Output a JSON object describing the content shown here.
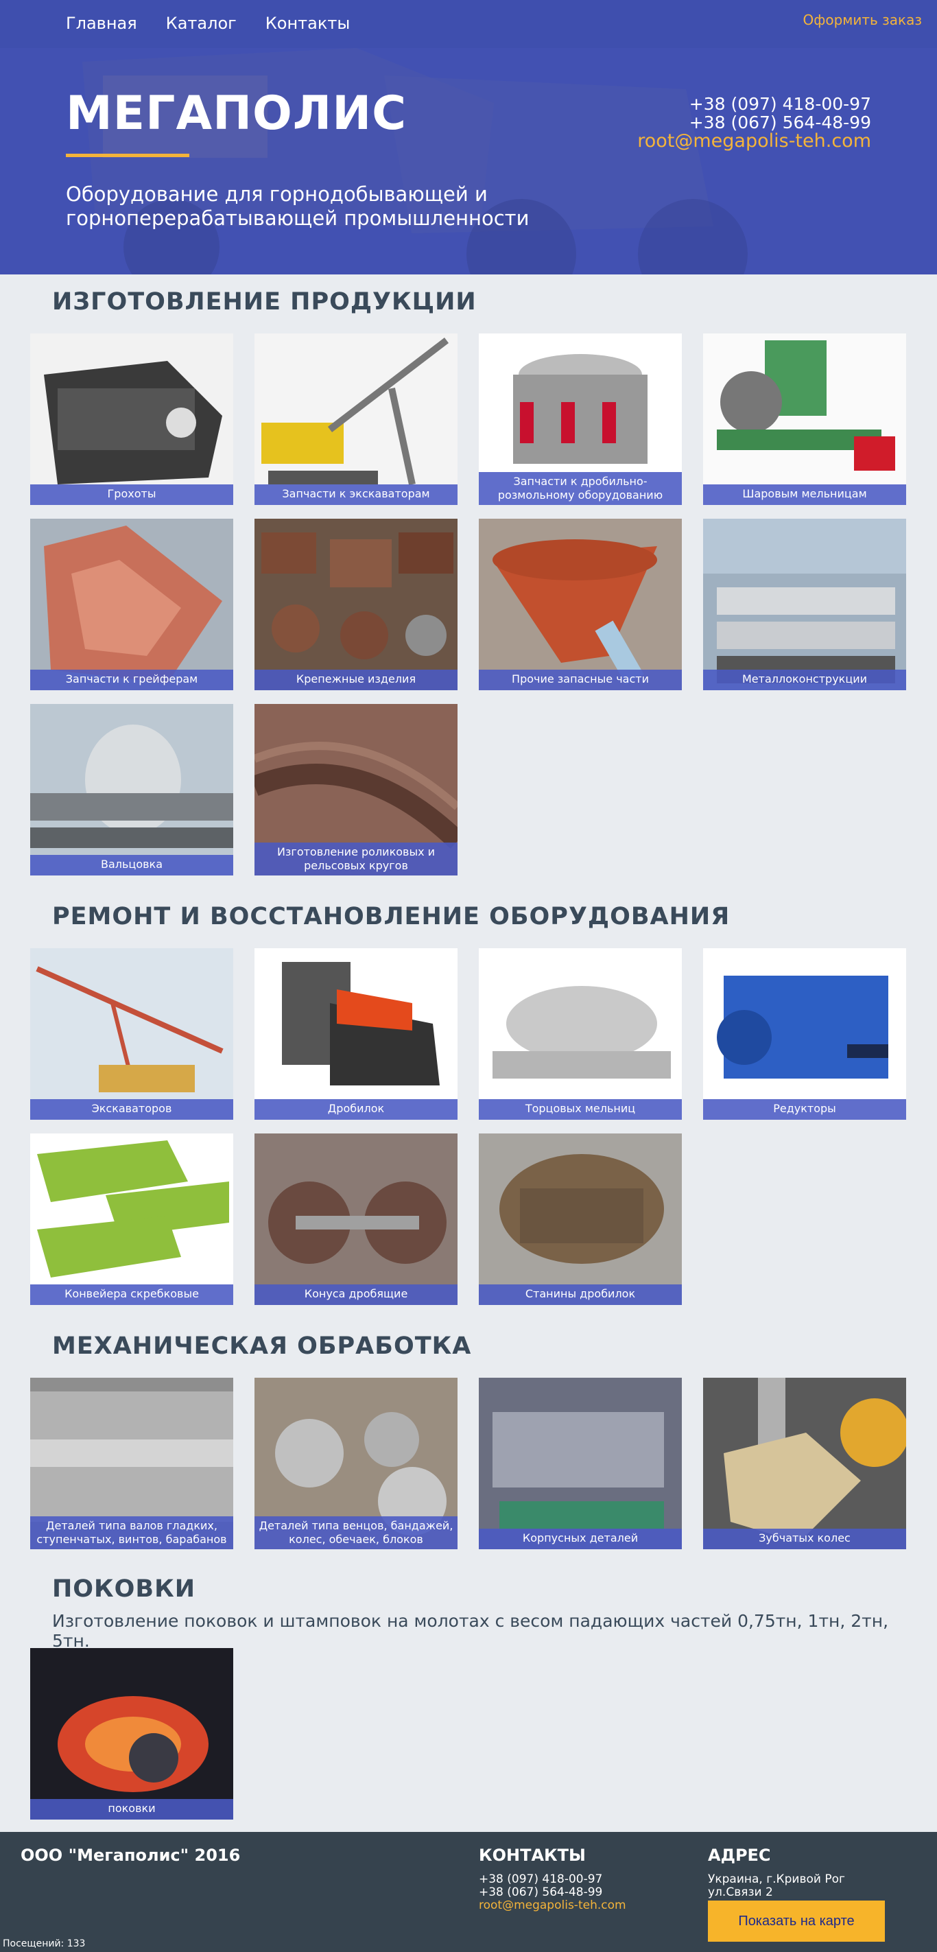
{
  "nav": {
    "links": [
      "Главная",
      "Каталог",
      "Контакты"
    ],
    "order": "Оформить заказ"
  },
  "hero": {
    "brand": "МЕГАПОЛИС",
    "tagline": "Оборудование для горнодобывающей и горноперерабатывающей промышленности",
    "phone1": "+38 (097) 418-00-97",
    "phone2": "+38 (067) 564-48-99",
    "email": "root@megapolis-teh.com"
  },
  "sections": {
    "production": {
      "title": "ИЗГОТОВЛЕНИЕ ПРОДУКЦИИ",
      "items": [
        "Грохоты",
        "Запчасти к экскаваторам",
        "Запчасти к дробильно-розмольному оборудованию",
        "Шаровым мельницам",
        "Запчасти к грейферам",
        "Крепежные изделия",
        "Прочие запасные части",
        "Металлоконструкции",
        "Вальцовка",
        "Изготовление роликовых и рельсовых кругов"
      ]
    },
    "repair": {
      "title": "РЕМОНТ И ВОССТАНОВЛЕНИЕ ОБОРУДОВАНИЯ",
      "items": [
        "Экскаваторов",
        "Дробилок",
        "Торцовых мельниц",
        "Редукторы",
        "Конвейера скребковые",
        "Конуса дробящие",
        "Станины дробилок"
      ]
    },
    "machining": {
      "title": "МЕХАНИЧЕСКАЯ ОБРАБОТКА",
      "items": [
        "Деталей типа валов гладких, ступенчатых, винтов, барабанов",
        "Деталей типа венцов, бандажей, колес, обечаек, блоков",
        "Корпусных деталей",
        "Зубчатых колес"
      ]
    },
    "forging": {
      "title": "ПОКОВКИ",
      "subtitle": "Изготовление поковок и штамповок на молотах с весом падающих частей 0,75тн, 1тн, 2тн, 5тн.",
      "items": [
        "поковки"
      ]
    }
  },
  "footer": {
    "company": "ООО \"Мегаполис\" 2016",
    "contacts_title": "КОНТАКТЫ",
    "phone1": "+38 (097) 418-00-97",
    "phone2": "+38 (067) 564-48-99",
    "email": "root@megapolis-teh.com",
    "address_title": "АДРЕС",
    "address1": "Украина, г.Кривой Рог",
    "address2": "ул.Связи 2",
    "map_button": "Показать на карте",
    "visits": "Посещений: 133"
  }
}
